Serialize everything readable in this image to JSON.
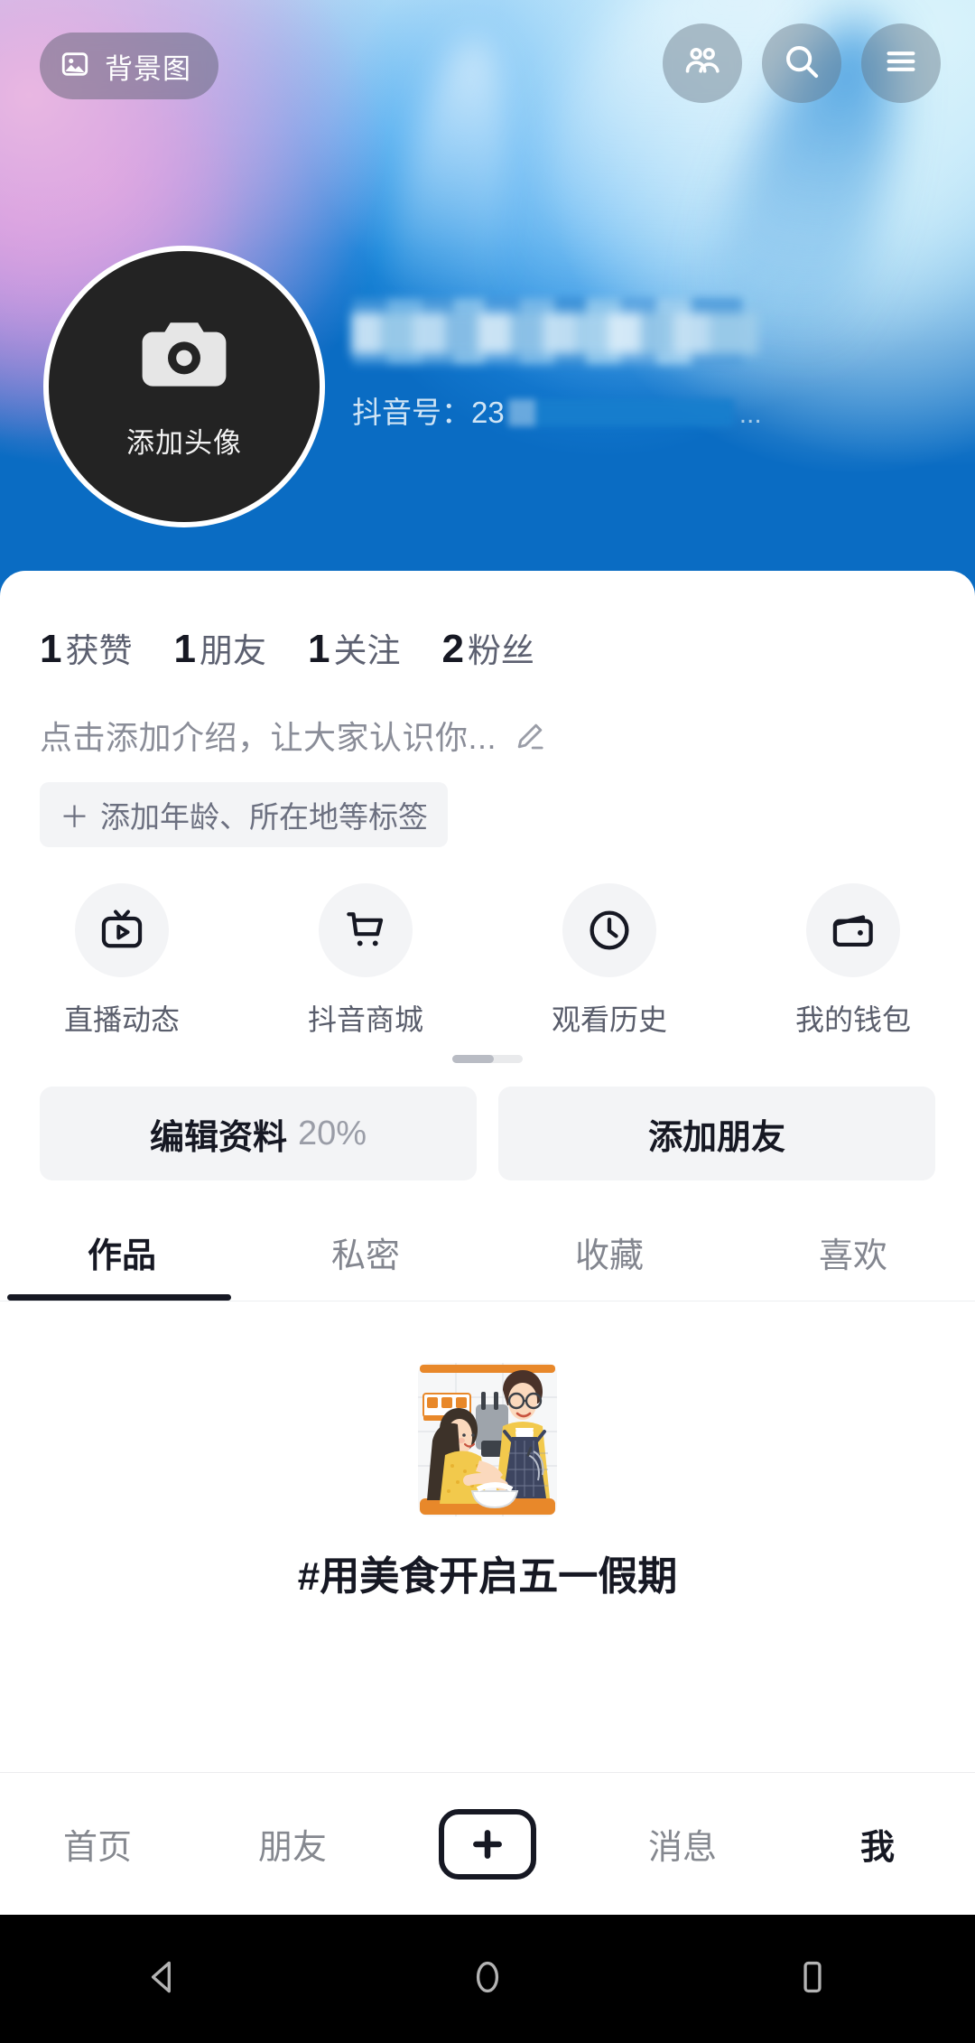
{
  "cover": {
    "background_button_label": "背景图",
    "background_button_icon": "image-icon",
    "actions": [
      {
        "name": "friends-icon",
        "label": "好友"
      },
      {
        "name": "search-icon",
        "label": "搜索"
      },
      {
        "name": "menu-icon",
        "label": "菜单"
      }
    ]
  },
  "profile": {
    "avatar_add_label": "添加头像",
    "avatar_icon": "camera-icon",
    "nickname": "",
    "douyin_id_label": "抖音号：",
    "douyin_id_value": "23",
    "douyin_id_ellipsis": "..."
  },
  "stats": [
    {
      "num": "1",
      "label": "获赞"
    },
    {
      "num": "1",
      "label": "朋友"
    },
    {
      "num": "1",
      "label": "关注"
    },
    {
      "num": "2",
      "label": "粉丝"
    }
  ],
  "bio": {
    "placeholder": "点击添加介绍，让大家认识你...",
    "edit_icon": "pencil-icon",
    "tag_plus": "＋",
    "tag_label": "添加年龄、所在地等标签"
  },
  "shortcuts": [
    {
      "icon": "live-tv-icon",
      "label": "直播动态"
    },
    {
      "icon": "shopping-cart-icon",
      "label": "抖音商城"
    },
    {
      "icon": "clock-icon",
      "label": "观看历史"
    },
    {
      "icon": "wallet-icon",
      "label": "我的钱包"
    }
  ],
  "actions": {
    "edit_profile_label": "编辑资料",
    "edit_profile_percent": "20%",
    "add_friend_label": "添加朋友"
  },
  "tabs": [
    {
      "label": "作品",
      "active": true
    },
    {
      "label": "私密",
      "active": false
    },
    {
      "label": "收藏",
      "active": false
    },
    {
      "label": "喜欢",
      "active": false
    }
  ],
  "content": {
    "promo_text": "#用美食开启五一假期",
    "illustration": "cooking-couple-illustration"
  },
  "bottom_nav": [
    {
      "label": "首页",
      "active": false
    },
    {
      "label": "朋友",
      "active": false
    },
    {
      "label": "＋",
      "active": false,
      "is_plus": true
    },
    {
      "label": "消息",
      "active": false
    },
    {
      "label": "我",
      "active": true
    }
  ],
  "system_bar": [
    {
      "icon": "back-icon"
    },
    {
      "icon": "home-icon"
    },
    {
      "icon": "recents-icon"
    }
  ],
  "colors": {
    "cover_blue": "#0a6cc3",
    "accent_dark": "#161823",
    "chip_bg": "#f3f4f6",
    "muted_text": "#83868f"
  }
}
